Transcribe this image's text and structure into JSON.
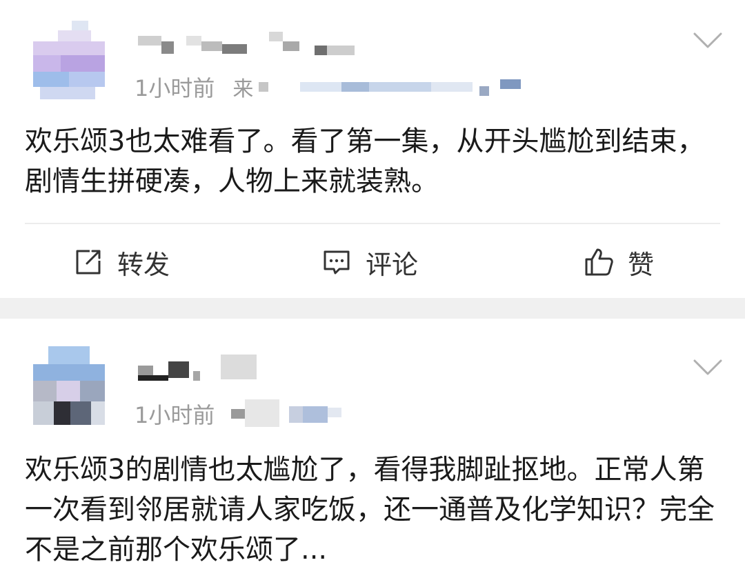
{
  "posts": [
    {
      "time": "1小时前",
      "source_prefix": "来",
      "text": "欢乐颂3也太难看了。看了第一集，从开头尴尬到结束，剧情生拼硬凑，人物上来就装熟。",
      "actions": {
        "repost": "转发",
        "comment": "评论",
        "like": "赞"
      }
    },
    {
      "time": "1小时前",
      "source_prefix": "",
      "text": "欢乐颂3的剧情也太尴尬了，看得我脚趾抠地。正常人第一次看到邻居就请人家吃饭，还一通普及化学知识？完全不是之前那个欢乐颂了..."
    }
  ],
  "icons": {
    "more": "chevron-down-icon",
    "repost": "share-icon",
    "comment": "comment-icon",
    "like": "thumbs-up-icon"
  },
  "colors": {
    "meta_gray": "#9a9a9a",
    "separator": "#f0f0f0"
  }
}
